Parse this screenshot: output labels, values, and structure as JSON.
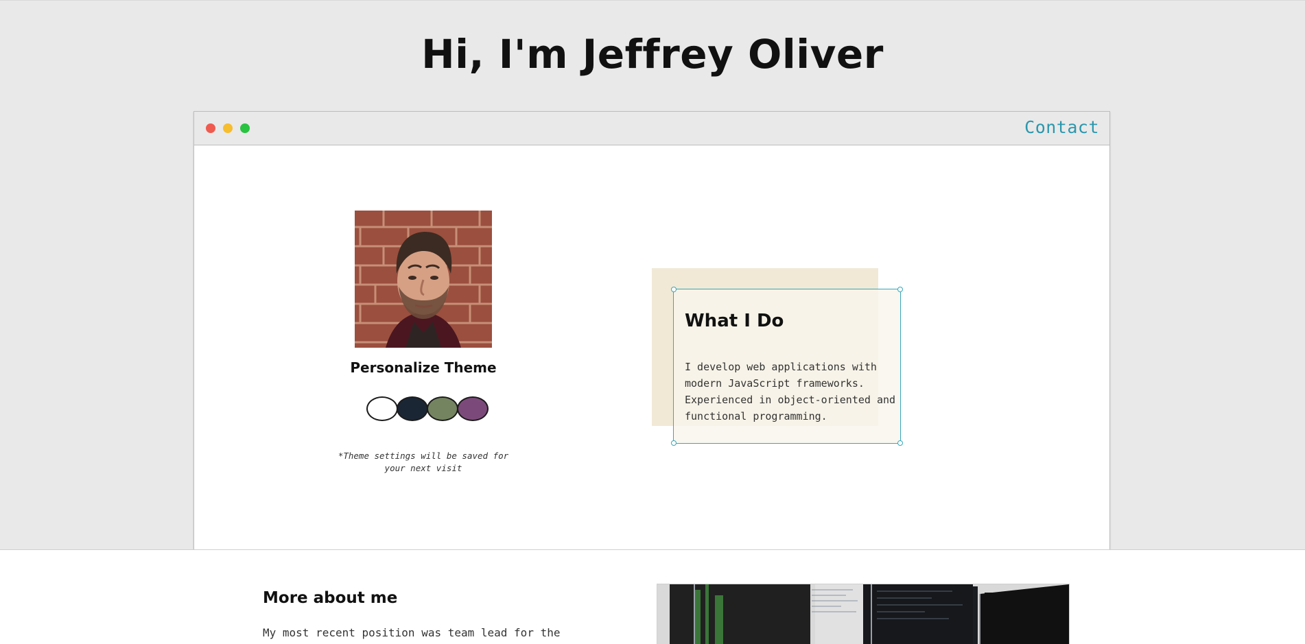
{
  "hero": {
    "title": "Hi, I'm Jeffrey Oliver"
  },
  "window": {
    "contact_label": "Contact",
    "controls": [
      "close",
      "minimize",
      "maximize"
    ]
  },
  "profile": {
    "photo_alt": "portrait-photo",
    "personalize_title": "Personalize Theme",
    "theme_swatches": [
      {
        "name": "white",
        "color": "#ffffff"
      },
      {
        "name": "navy",
        "color": "#1b2635"
      },
      {
        "name": "sage",
        "color": "#748460"
      },
      {
        "name": "plum",
        "color": "#7c4a7a"
      }
    ],
    "note": "*Theme settings will be saved for your next visit"
  },
  "what_i_do": {
    "title": "What I Do",
    "text": "I develop web applications with modern JavaScript frameworks. Experienced in object-oriented and functional programming."
  },
  "more_about": {
    "title": "More about me",
    "text": "My most recent position was team lead for the"
  },
  "colors": {
    "background": "#e9e9e9",
    "accent": "#2b97ad",
    "card_back": "#f1e9d6",
    "card_front": "#f8f5ec"
  }
}
